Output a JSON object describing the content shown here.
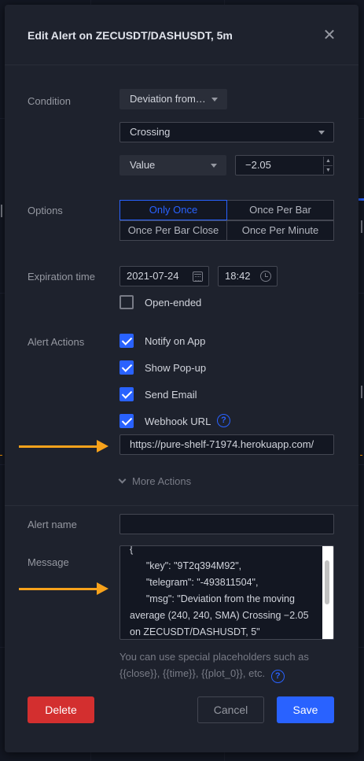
{
  "dialog": {
    "title": "Edit Alert on ZECUSDT/DASHUSDT, 5m",
    "close_glyph": "✕"
  },
  "condition": {
    "label": "Condition",
    "indicator": "Deviation from…",
    "operator": "Crossing",
    "value_type": "Value",
    "value": "−2.05"
  },
  "options": {
    "label": "Options",
    "items": [
      "Only Once",
      "Once Per Bar",
      "Once Per Bar Close",
      "Once Per Minute"
    ],
    "selected": "Only Once"
  },
  "expiration": {
    "label": "Expiration time",
    "date": "2021-07-24",
    "time": "18:42",
    "open_ended_label": "Open-ended",
    "open_ended_checked": false
  },
  "actions": {
    "label": "Alert Actions",
    "items": [
      {
        "label": "Notify on App",
        "checked": true
      },
      {
        "label": "Show Pop-up",
        "checked": true
      },
      {
        "label": "Send Email",
        "checked": true
      },
      {
        "label": "Webhook URL",
        "checked": true
      }
    ],
    "webhook_url": "https://pure-shelf-71974.herokuapp.com/",
    "help_glyph": "?",
    "more_actions": "More Actions"
  },
  "alert_name": {
    "label": "Alert name",
    "value": ""
  },
  "message": {
    "label": "Message",
    "text": "{\n      \"key\": \"9T2q394M92\",\n      \"telegram\": \"-493811504\",\n      \"msg\": \"Deviation from the moving average (240, 240, SMA) Crossing −2.05 on ZECUSDT/DASHUSDT, 5\"\n}",
    "hint": "You can use special placeholders such as {{close}}, {{time}}, {{plot_0}}, etc."
  },
  "buttons": {
    "delete": "Delete",
    "cancel": "Cancel",
    "save": "Save"
  },
  "colors": {
    "accent": "#2962ff",
    "danger": "#d32f2f",
    "annotation_arrow": "#f7a21b",
    "dialog_bg": "#1e222d"
  },
  "icons": [
    "close-icon",
    "caret-down-icon",
    "calendar-icon",
    "clock-icon",
    "checkbox-icon",
    "help-icon",
    "chevron-down-icon",
    "arrow-annotation-icon"
  ]
}
